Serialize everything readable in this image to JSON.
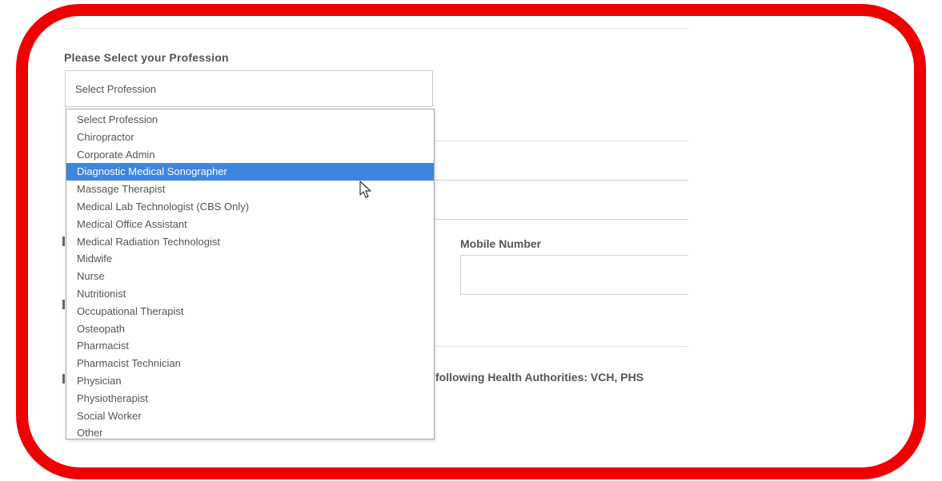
{
  "form": {
    "profession_label": "Please Select your Profession",
    "profession_select": {
      "current_value": "Select Profession",
      "highlighted_option": "Diagnostic Medical Sonographer",
      "options": [
        "Select Profession",
        "Chiropractor",
        "Corporate Admin",
        "Diagnostic Medical Sonographer",
        "Massage Therapist",
        "Medical Lab Technologist (CBS Only)",
        "Medical Office Assistant",
        "Medical Radiation Technologist",
        "Midwife",
        "Nurse",
        "Nutritionist",
        "Occupational Therapist",
        "Osteopath",
        "Pharmacist",
        "Pharmacist Technician",
        "Physician",
        "Physiotherapist",
        "Social Worker",
        "Other"
      ]
    },
    "mobile_number_label": "Mobile Number",
    "mobile_number_value": "",
    "health_authorities_text": "following Health Authorities: VCH, PHS"
  },
  "colors": {
    "highlight_frame": "#ee0000",
    "selected_option_bg": "#3d86e0"
  },
  "icons": {
    "cursor": "mouse-pointer-icon"
  }
}
